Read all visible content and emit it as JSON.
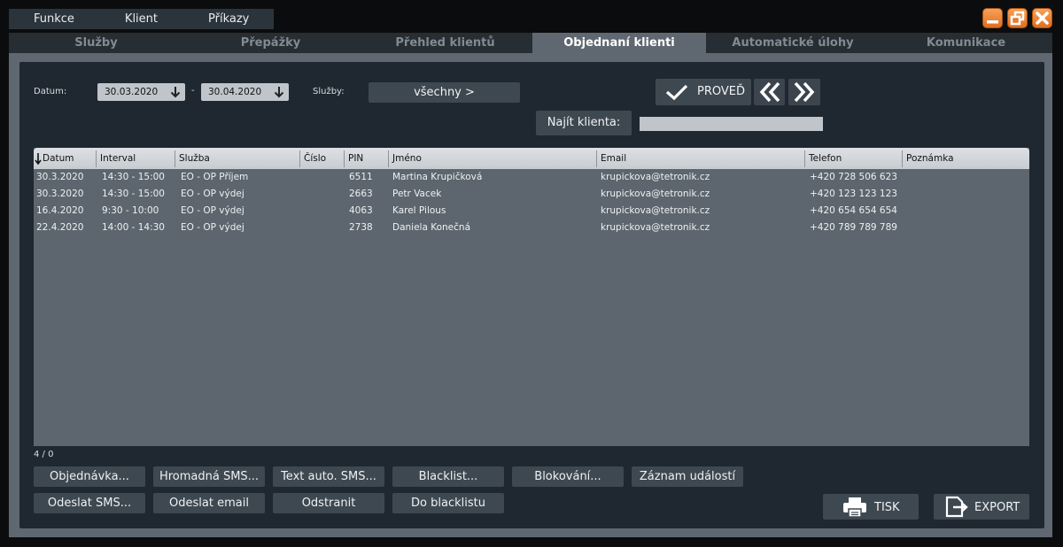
{
  "menu": {
    "items": [
      "Funkce",
      "Klient",
      "Příkazy"
    ]
  },
  "tabs": [
    "Služby",
    "Přepážky",
    "Přehled klientů",
    "Objednaní klienti",
    "Automatické úlohy",
    "Komunikace"
  ],
  "active_tab": "Objednaní klienti",
  "filter": {
    "datum_label": "Datum:",
    "date_from": "30.03.2020",
    "dash": "-",
    "date_to": "30.04.2020",
    "sluzby_label": "Služby:",
    "sluzby_value": "všechny >",
    "proved_label": "PROVEĎ",
    "najit_label": "Najít klienta:",
    "najit_value": ""
  },
  "table": {
    "columns": [
      "Datum",
      "Interval",
      "Služba",
      "Číslo",
      "PIN",
      "Jméno",
      "Email",
      "Telefon",
      "Poznámka"
    ],
    "rows": [
      [
        "30.3.2020",
        "14:30 - 15:00",
        "EO - OP Příjem",
        "",
        "6511",
        "Martina Krupičková",
        "krupickova@tetronik.cz",
        "+420 728 506 623",
        ""
      ],
      [
        "30.3.2020",
        "14:30 - 15:00",
        "EO - OP výdej",
        "",
        "2663",
        "Petr Vacek",
        "krupickova@tetronik.cz",
        "+420 123 123 123",
        ""
      ],
      [
        "16.4.2020",
        "9:30 - 10:00",
        "EO - OP výdej",
        "",
        "4063",
        "Karel Pilous",
        "krupickova@tetronik.cz",
        "+420 654 654 654",
        ""
      ],
      [
        "22.4.2020",
        "14:00 - 14:30",
        "EO - OP výdej",
        "",
        "2738",
        "Daniela Konečná",
        "krupickova@tetronik.cz",
        "+420 789 789 789",
        ""
      ]
    ]
  },
  "count": "4 / 0",
  "actions": {
    "row1": [
      "Objednávka...",
      "Hromadná SMS...",
      "Text auto. SMS...",
      "Blacklist...",
      "Blokování...",
      "Záznam událostí"
    ],
    "row2": [
      "Odeslat SMS...",
      "Odeslat email",
      "Odstranit",
      "Do blacklistu"
    ]
  },
  "tisk_label": "TISK",
  "export_label": "EXPORT",
  "colors": {
    "accent_orange": "#f08a34",
    "panel": "#1f2830",
    "frame": "#5f6870",
    "input": "#bfc5ca"
  }
}
